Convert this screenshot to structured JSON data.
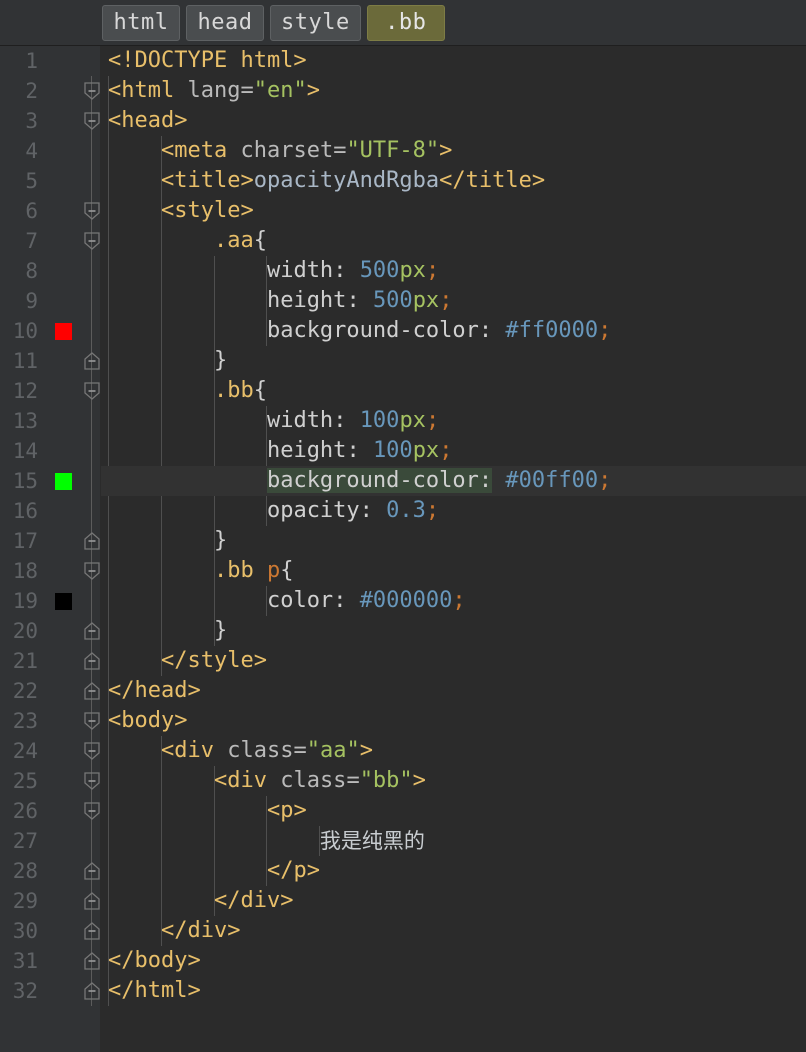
{
  "breadcrumb": {
    "items": [
      {
        "label": "html",
        "active": false
      },
      {
        "label": "head",
        "active": false
      },
      {
        "label": "style",
        "active": false
      },
      {
        "label": ".bb",
        "active": true
      }
    ]
  },
  "editor": {
    "current_line": 15,
    "total_lines": 32,
    "theme": {
      "background": "#2b2b2b",
      "gutter_background": "#313335",
      "current_line_background": "#323232",
      "line_number_color": "#606366",
      "tag_color": "#e8bf6a",
      "attribute_color": "#bababa",
      "attribute_value_color": "#a5c261",
      "text_color": "#a9b7c6",
      "number_color": "#6897bb",
      "punctuation_color": "#cc7832",
      "selector_color": "#e8bf6a",
      "element_selector_color": "#cc7832"
    },
    "gutter_swatches": [
      {
        "line": 10,
        "color": "#ff0000"
      },
      {
        "line": 15,
        "color": "#00ff00"
      },
      {
        "line": 19,
        "color": "#000000"
      }
    ],
    "lines": [
      {
        "n": 1,
        "text": "<!DOCTYPE html>"
      },
      {
        "n": 2,
        "text": "<html lang=\"en\">"
      },
      {
        "n": 3,
        "text": "<head>"
      },
      {
        "n": 4,
        "text": "    <meta charset=\"UTF-8\">"
      },
      {
        "n": 5,
        "text": "    <title>opacityAndRgba</title>"
      },
      {
        "n": 6,
        "text": "    <style>"
      },
      {
        "n": 7,
        "text": "        .aa{"
      },
      {
        "n": 8,
        "text": "            width: 500px;"
      },
      {
        "n": 9,
        "text": "            height: 500px;"
      },
      {
        "n": 10,
        "text": "            background-color: #ff0000;"
      },
      {
        "n": 11,
        "text": "        }"
      },
      {
        "n": 12,
        "text": "        .bb{"
      },
      {
        "n": 13,
        "text": "            width: 100px;"
      },
      {
        "n": 14,
        "text": "            height: 100px;"
      },
      {
        "n": 15,
        "text": "            background-color: #00ff00;"
      },
      {
        "n": 16,
        "text": "            opacity: 0.3;"
      },
      {
        "n": 17,
        "text": "        }"
      },
      {
        "n": 18,
        "text": "        .bb p{"
      },
      {
        "n": 19,
        "text": "            color: #000000;"
      },
      {
        "n": 20,
        "text": "        }"
      },
      {
        "n": 21,
        "text": "    </style>"
      },
      {
        "n": 22,
        "text": "</head>"
      },
      {
        "n": 23,
        "text": "<body>"
      },
      {
        "n": 24,
        "text": "    <div class=\"aa\">"
      },
      {
        "n": 25,
        "text": "        <div class=\"bb\">"
      },
      {
        "n": 26,
        "text": "            <p>"
      },
      {
        "n": 27,
        "text": "                我是纯黑的"
      },
      {
        "n": 28,
        "text": "            </p>"
      },
      {
        "n": 29,
        "text": "        </div>"
      },
      {
        "n": 30,
        "text": "    </div>"
      },
      {
        "n": 31,
        "text": "</body>"
      },
      {
        "n": 32,
        "text": "</html>"
      }
    ]
  }
}
